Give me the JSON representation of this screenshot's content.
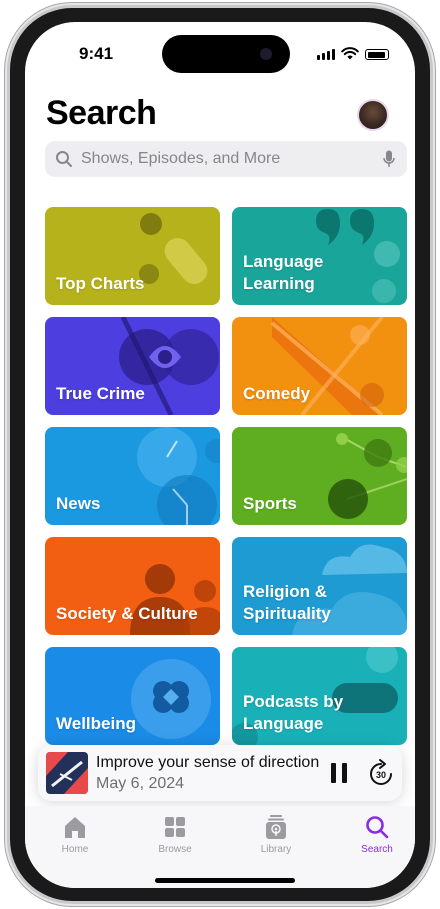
{
  "status_bar": {
    "time": "9:41"
  },
  "header": {
    "title": "Search"
  },
  "search": {
    "placeholder": "Shows, Episodes, and More"
  },
  "categories": [
    {
      "label": "Top Charts",
      "color": "#b6b21c"
    },
    {
      "label": "Language Learning",
      "color": "#1aa59a"
    },
    {
      "label": "True Crime",
      "color": "#4d3ee0"
    },
    {
      "label": "Comedy",
      "color": "#f29010"
    },
    {
      "label": "News",
      "color": "#1a98e0"
    },
    {
      "label": "Sports",
      "color": "#5fae22"
    },
    {
      "label": "Society & Culture",
      "color": "#f25f12"
    },
    {
      "label": "Religion & Spirituality",
      "color": "#1e9bd2"
    },
    {
      "label": "Wellbeing",
      "color": "#1a8be6"
    },
    {
      "label": "Podcasts by Language",
      "color": "#1ab0b8"
    }
  ],
  "mini_player": {
    "title": "Improve your sense of direction",
    "date": "May 6, 2024",
    "skip_seconds": "30"
  },
  "tabs": [
    {
      "label": "Home",
      "icon": "house-icon"
    },
    {
      "label": "Browse",
      "icon": "grid-icon"
    },
    {
      "label": "Library",
      "icon": "library-icon"
    },
    {
      "label": "Search",
      "icon": "search-icon",
      "active": true
    }
  ],
  "colors": {
    "accent": "#8a2be2",
    "search_bg": "#eeeef0"
  }
}
